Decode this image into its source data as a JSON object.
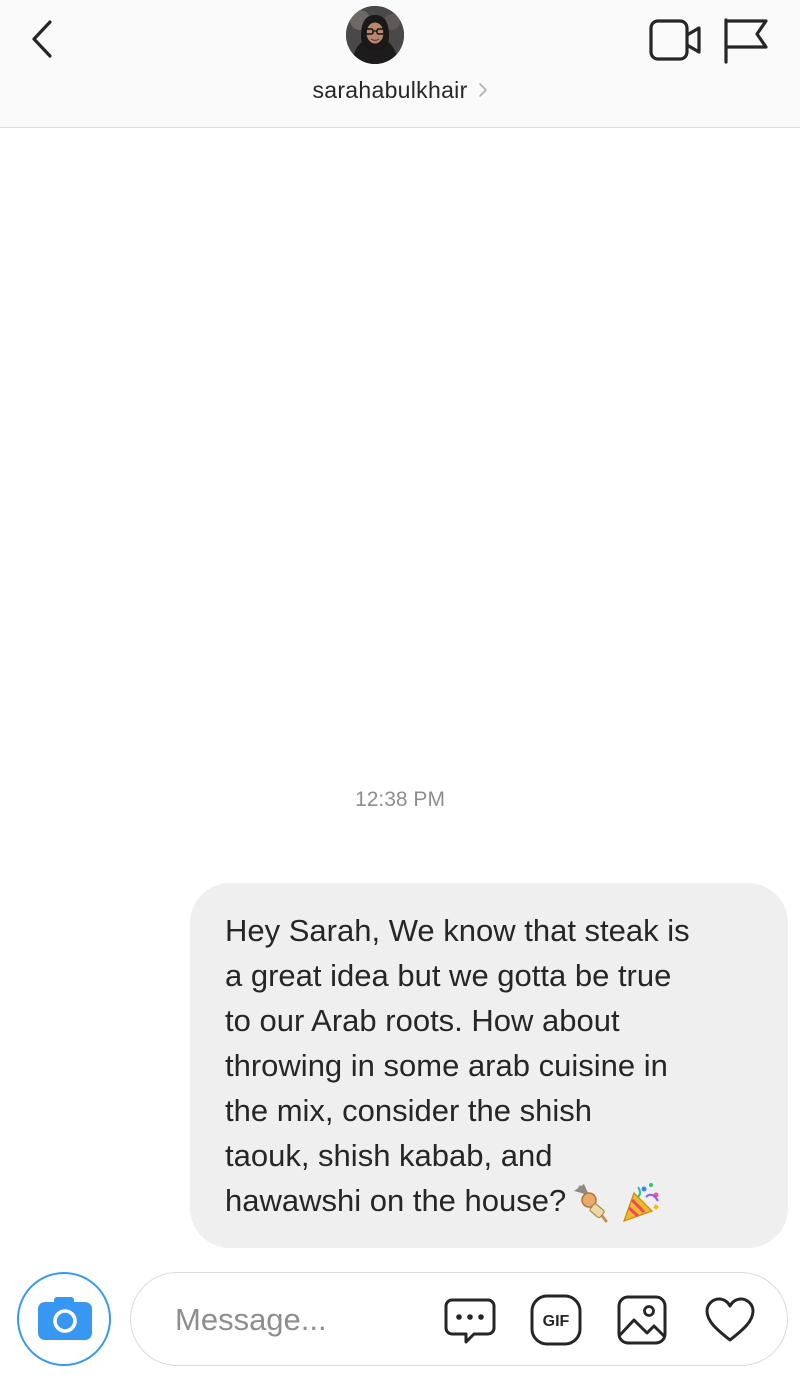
{
  "header": {
    "username": "sarahabulkhair",
    "icons": {
      "back": "chevron-left-icon",
      "username_chevron": "chevron-right-icon",
      "video_call": "video-camera-icon",
      "report": "flag-icon"
    }
  },
  "thread": {
    "timestamp": "12:38 PM",
    "messages": [
      {
        "sender": "me",
        "text": "Hey Sarah, We know that steak is\na great idea but we gotta be true\nto our Arab roots. How about\nthrowing in some arab cuisine in\nthe mix, consider the shish\ntaouk, shish kabab, and\nhawawshi on the house?",
        "emojis": [
          "oden-skewer-emoji",
          "party-popper-emoji"
        ]
      }
    ]
  },
  "composer": {
    "placeholder": "Message...",
    "icons": [
      "camera-icon",
      "chat-bubble-dots-icon",
      "gif-icon",
      "gallery-icon",
      "heart-icon"
    ]
  },
  "colors": {
    "accent": "#3897f0",
    "bubble": "#efefef",
    "header_bg": "#fafafa",
    "border": "#dbdbdb",
    "muted_text": "#8e8e8e"
  }
}
